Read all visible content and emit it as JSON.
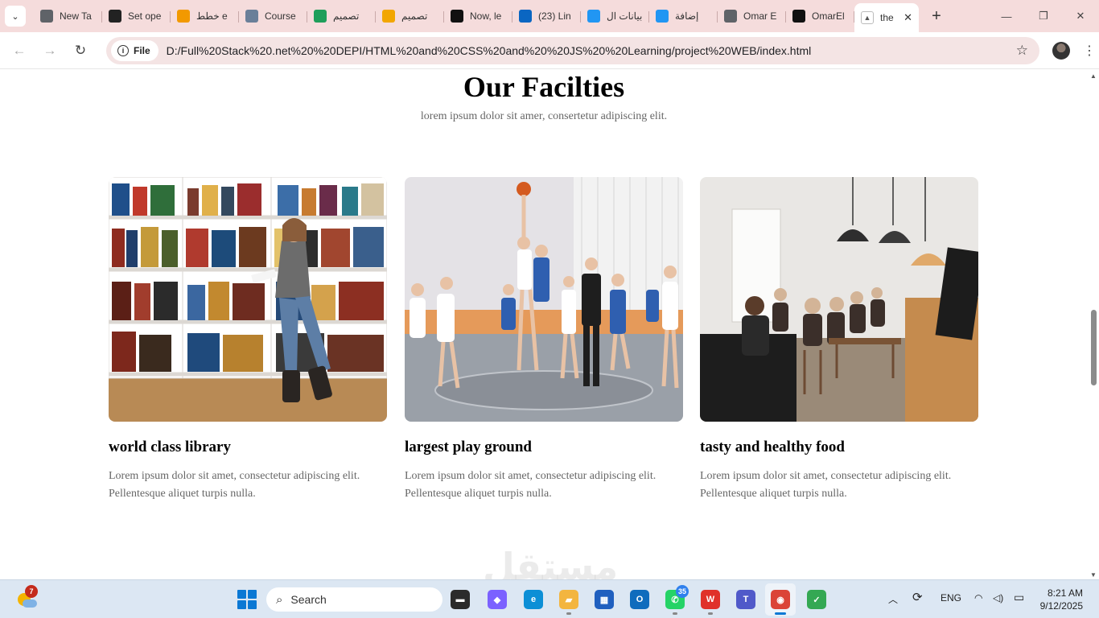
{
  "browser": {
    "tabs": [
      {
        "title": "New Ta",
        "icon": "chrome-icon",
        "color": "#5f6368"
      },
      {
        "title": "Set ope",
        "icon": "openai-icon",
        "color": "#222222"
      },
      {
        "title": "خطط e",
        "icon": "info-icon",
        "color": "#f29900"
      },
      {
        "title": "Course",
        "icon": "course-icon",
        "color": "#6a7f99"
      },
      {
        "title": "تصميم",
        "icon": "khamsat-icon",
        "color": "#1e9e5a"
      },
      {
        "title": "تصميم",
        "icon": "five-icon",
        "color": "#f2a600"
      },
      {
        "title": "Now, le",
        "icon": "upwork-icon",
        "color": "#111111"
      },
      {
        "title": "(23) Lin",
        "icon": "linkedin-icon",
        "color": "#0a66c2"
      },
      {
        "title": "بيانات ال",
        "icon": "mostaql-icon",
        "color": "#2196f3"
      },
      {
        "title": "إضافة",
        "icon": "mostaql-icon",
        "color": "#2196f3"
      },
      {
        "title": "Omar E",
        "icon": "globe-icon",
        "color": "#5f6368"
      },
      {
        "title": "OmarEl",
        "icon": "github-icon",
        "color": "#111111"
      }
    ],
    "active_tab": {
      "title": "the",
      "icon": "page-icon"
    },
    "tab_search_glyph": "⌄",
    "new_tab_glyph": "+",
    "close_glyph": "✕",
    "window_controls": {
      "minimize": "—",
      "restore": "❐",
      "close": "✕"
    },
    "toolbar": {
      "back_glyph": "←",
      "forward_glyph": "→",
      "reload_glyph": "↻",
      "info_glyph": "i",
      "file_chip": "File",
      "url": "D:/Full%20Stack%20.net%20%20DEPI/HTML%20and%20CSS%20and%20%20JS%20%20Learning/project%20WEB/index.html",
      "bookmark_glyph": "☆",
      "menu_glyph": "⋮"
    }
  },
  "page": {
    "section_title": "Our Facilties",
    "section_subtitle": "lorem ipsum dolor sit amer, consertetur adipiscing elit.",
    "cards": [
      {
        "image": "library-photo",
        "title": "world class library",
        "text": "Lorem ipsum dolor sit amet, consectetur adipiscing elit. Pellentesque aliquet turpis nulla."
      },
      {
        "image": "basketball-photo",
        "title": "largest play ground",
        "text": "Lorem ipsum dolor sit amet, consectetur adipiscing elit. Pellentesque aliquet turpis nulla."
      },
      {
        "image": "cafe-photo",
        "title": "tasty and healthy food",
        "text": "Lorem ipsum dolor sit amet, consectetur adipiscing elit. Pellentesque aliquet turpis nulla."
      }
    ],
    "watermark": "مستقل"
  },
  "scrollbar": {
    "up_glyph": "▲",
    "down_glyph": "▼"
  },
  "taskbar": {
    "weather_badge": "7",
    "search_placeholder": "Search",
    "search_glyph": "⌕",
    "apps": [
      {
        "name": "file-explorer-dark",
        "label": "▬",
        "color": "#2b2b2b"
      },
      {
        "name": "copilot",
        "label": "◆",
        "color": "#7b61ff"
      },
      {
        "name": "edge",
        "label": "e",
        "color": "#0c8fd6"
      },
      {
        "name": "file-explorer",
        "label": "▰",
        "color": "#f3b53f"
      },
      {
        "name": "microsoft-store",
        "label": "▦",
        "color": "#1f5fbf"
      },
      {
        "name": "outlook",
        "label": "O",
        "color": "#0f6cbd"
      },
      {
        "name": "whatsapp",
        "label": "✆",
        "color": "#25d366"
      },
      {
        "name": "wps-office",
        "label": "W",
        "color": "#e0312a"
      },
      {
        "name": "teams",
        "label": "T",
        "color": "#5059c9"
      },
      {
        "name": "chrome",
        "label": "◉",
        "color": "#db4437"
      },
      {
        "name": "clipchamp",
        "label": "✓",
        "color": "#34a853"
      }
    ],
    "whatsapp_badge": "35",
    "tray": {
      "chevron": "︿",
      "sync_glyph": "⟳",
      "language": "ENG",
      "wifi_glyph": "◠",
      "volume_glyph": "◁)",
      "battery_glyph": "▭"
    },
    "clock": {
      "time": "8:21 AM",
      "date": "9/12/2025"
    }
  },
  "colors": {
    "tab_strip": "#f5dcdc",
    "omnibox": "#f4e4e4",
    "taskbar": "#dce7f3",
    "body_text": "#666666"
  }
}
